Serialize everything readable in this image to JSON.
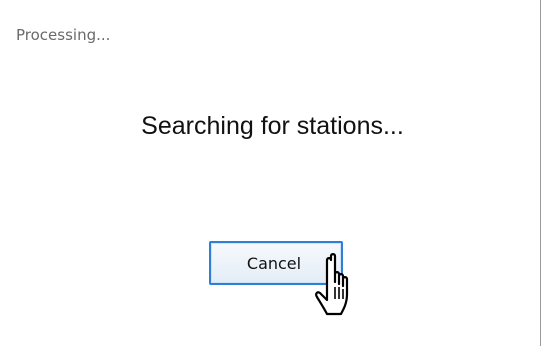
{
  "dialog": {
    "title": "Processing...",
    "message": "Searching for stations...",
    "cancel_label": "Cancel"
  },
  "cursor": {
    "icon": "hand-pointer-icon"
  }
}
